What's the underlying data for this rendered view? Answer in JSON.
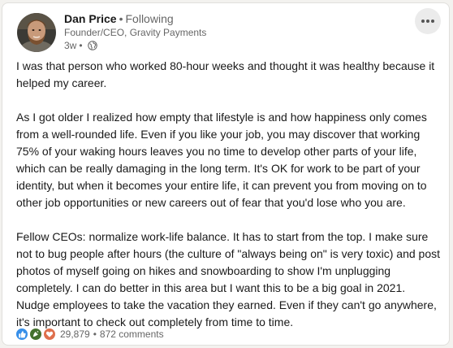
{
  "author": {
    "name": "Dan Price",
    "separator": "•",
    "follow_status": "Following",
    "headline": "Founder/CEO, Gravity Payments",
    "age": "3w",
    "age_separator": "•",
    "visibility_icon": "globe-icon"
  },
  "menu": {
    "icon": "more-horizontal-icon"
  },
  "post": {
    "paragraphs": [
      "I was that person who worked 80-hour weeks and thought it was healthy because it helped my career.",
      "As I got older I realized how empty that lifestyle is and how happiness only comes from a well-rounded life. Even if you like your job, you may discover that working 75% of your waking hours leaves you no time to develop other parts of your life, which can be really damaging in the long term. It's OK for work to be part of your identity, but when it becomes your entire life, it can prevent you from moving on to other job opportunities or new careers out of fear that you'd lose who you are.",
      "Fellow CEOs: normalize work-life balance. It has to start from the top. I make sure not to bug people after hours (the culture of \"always being on\" is very toxic) and post photos of myself going on hikes and snowboarding to show I'm unplugging completely. I can do better in this area but I want this to be a big goal in 2021. Nudge employees to take the vacation they earned. Even if they can't go anywhere, it's important to check out completely from time to time."
    ]
  },
  "social": {
    "reaction_icons": [
      "like-icon",
      "celebrate-icon",
      "love-icon"
    ],
    "reaction_count": "29,879",
    "separator": "•",
    "comments": "872 comments"
  },
  "colors": {
    "like": "#378fe9",
    "celebrate": "#44712e",
    "love": "#df704d",
    "text_secondary": "#666666"
  }
}
